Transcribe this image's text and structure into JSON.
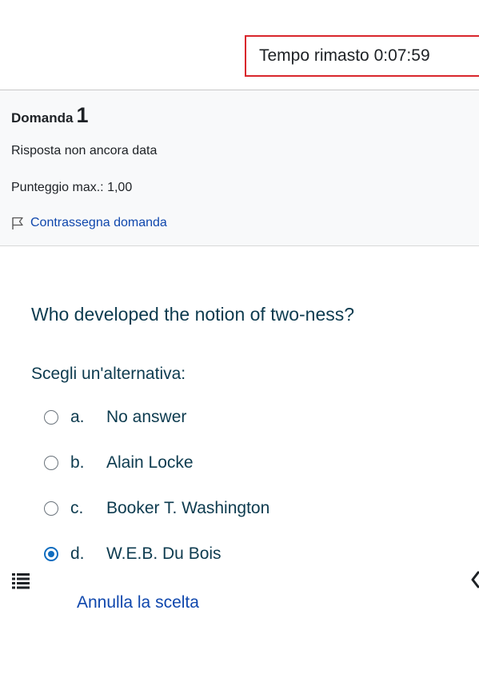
{
  "timer": {
    "label": "Tempo rimasto",
    "value": "0:07:59"
  },
  "question_info": {
    "title": "Domanda",
    "number": "1",
    "state": "Risposta non ancora data",
    "grade": "Punteggio max.: 1,00",
    "flag_label": "Contrassegna domanda",
    "flag_icon": "flag-icon"
  },
  "question": {
    "text": "Who developed the notion of two-ness?",
    "prompt": "Scegli un'alternativa:",
    "options": [
      {
        "letter": "a.",
        "label": "No answer",
        "selected": false
      },
      {
        "letter": "b.",
        "label": "Alain Locke",
        "selected": false
      },
      {
        "letter": "c.",
        "label": "Booker T. Washington",
        "selected": false
      },
      {
        "letter": "d.",
        "label": "W.E.B. Du Bois",
        "selected": true
      }
    ],
    "clear_label": "Annulla la scelta"
  },
  "icons": {
    "drawer": "list-icon",
    "drawer_right": "chevron-left-icon"
  },
  "colors": {
    "accent": "#0f6cbf",
    "link": "#0f47ad",
    "timer_border": "#d9262c",
    "question_text": "#0d3b4f"
  }
}
